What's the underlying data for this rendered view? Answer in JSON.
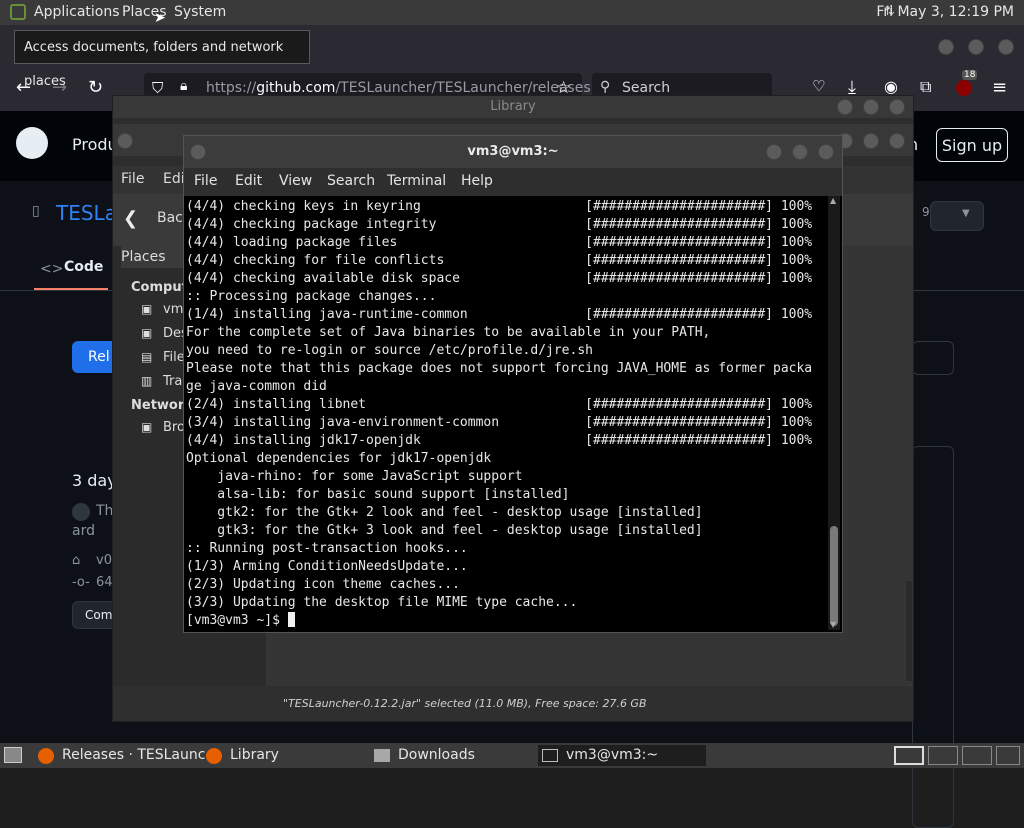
{
  "top_panel": {
    "applications": "Applications",
    "places": "Places",
    "system": "System",
    "clock": "Fri May  3, 12:19 PM"
  },
  "tooltip": "Access documents, folders and network places",
  "firefox": {
    "url_prefix": "https://",
    "url_host": "github.com",
    "url_path": "/TESLauncher/TESLauncher/releases",
    "search_placeholder": "Search",
    "notification_count": "18"
  },
  "github": {
    "nav_product": "Produ",
    "sign_in": "n",
    "sign_up": "Sign up",
    "repo": "TESLa",
    "code_tab": "Code",
    "releases_button": "Rel",
    "release_age": "3 day",
    "release_line1": "Th",
    "release_line2": "ard",
    "tag": "v0",
    "commit": "64",
    "compare": "Com",
    "star_count": "9"
  },
  "file_manager": {
    "title": "Library",
    "menu": [
      "File",
      "Edi"
    ],
    "back": "Back",
    "places_label": "Places",
    "computer_header": "Comput",
    "computer_items": [
      "vm",
      "Des",
      "File",
      "Tra"
    ],
    "network_header": "Network",
    "network_items": [
      "Bro"
    ],
    "status": "\"TESLauncher-0.12.2.jar\" selected (11.0 MB), Free space: 27.6 GB"
  },
  "terminal": {
    "title": "vm3@vm3:~",
    "menu": [
      "File",
      "Edit",
      "View",
      "Search",
      "Terminal",
      "Help"
    ],
    "lines": [
      "(4/4) checking keys in keyring                     [######################] 100%",
      "(4/4) checking package integrity                   [######################] 100%",
      "(4/4) loading package files                        [######################] 100%",
      "(4/4) checking for file conflicts                  [######################] 100%",
      "(4/4) checking available disk space                [######################] 100%",
      ":: Processing package changes...",
      "(1/4) installing java-runtime-common               [######################] 100%",
      "For the complete set of Java binaries to be available in your PATH,",
      "you need to re-login or source /etc/profile.d/jre.sh",
      "Please note that this package does not support forcing JAVA_HOME as former packa",
      "ge java-common did",
      "(2/4) installing libnet                            [######################] 100%",
      "(3/4) installing java-environment-common           [######################] 100%",
      "(4/4) installing jdk17-openjdk                     [######################] 100%",
      "Optional dependencies for jdk17-openjdk",
      "    java-rhino: for some JavaScript support",
      "    alsa-lib: for basic sound support [installed]",
      "    gtk2: for the Gtk+ 2 look and feel - desktop usage [installed]",
      "    gtk3: for the Gtk+ 3 look and feel - desktop usage [installed]",
      ":: Running post-transaction hooks...",
      "(1/3) Arming ConditionNeedsUpdate...",
      "(2/3) Updating icon theme caches...",
      "(3/3) Updating the desktop file MIME type cache..."
    ],
    "prompt": "[vm3@vm3 ~]$ "
  },
  "taskbar": {
    "items": [
      "Releases · TESLaunc...",
      "Library",
      "Downloads",
      "vm3@vm3:~"
    ]
  }
}
